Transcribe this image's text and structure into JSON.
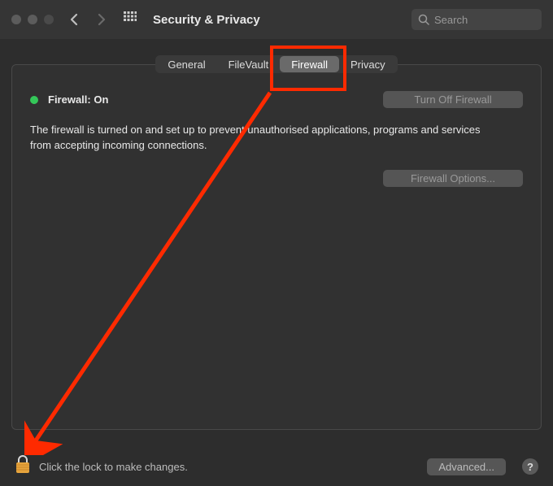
{
  "window": {
    "title": "Security & Privacy"
  },
  "search": {
    "placeholder": "Search"
  },
  "tabs": {
    "general": "General",
    "filevault": "FileVault",
    "firewall": "Firewall",
    "privacy": "Privacy"
  },
  "firewall": {
    "status_label": "Firewall: On",
    "status_color": "#34c759",
    "turn_off_label": "Turn Off Firewall",
    "description": "The firewall is turned on and set up to prevent unauthorised applications, programs and services from accepting incoming connections.",
    "options_label": "Firewall Options..."
  },
  "footer": {
    "lock_text": "Click the lock to make changes.",
    "advanced_label": "Advanced...",
    "help_label": "?"
  }
}
